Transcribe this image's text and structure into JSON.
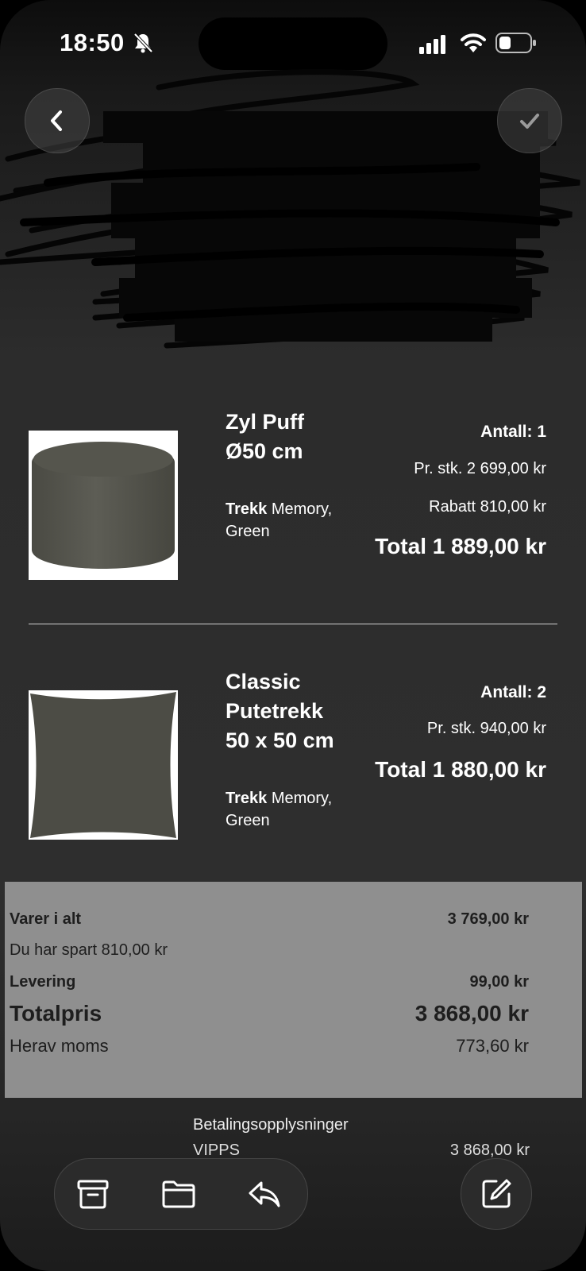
{
  "status": {
    "time": "18:50"
  },
  "items": [
    {
      "name_line1": "Zyl Puff",
      "name_line2": "Ø50 cm",
      "trekk_label": "Trekk",
      "trekk_value": "Memory,",
      "trekk_value2": "Green",
      "quantity": "Antall: 1",
      "unit_price": "Pr. stk. 2 699,00 kr",
      "discount": "Rabatt 810,00 kr",
      "total": "Total 1 889,00 kr"
    },
    {
      "name_line1": "Classic",
      "name_line2": "Putetrekk",
      "name_line3": "50 x 50 cm",
      "trekk_label": "Trekk",
      "trekk_value": "Memory,",
      "trekk_value2": "Green",
      "quantity": "Antall: 2",
      "unit_price": "Pr. stk. 940,00 kr",
      "total": "Total 1 880,00 kr"
    }
  ],
  "summary": {
    "items_label": "Varer i alt",
    "items_value": "3 769,00 kr",
    "saved": "Du har spart 810,00 kr",
    "delivery_label": "Levering",
    "delivery_value": "99,00 kr",
    "total_label": "Totalpris",
    "total_value": "3 868,00 kr",
    "vat_label": "Herav moms",
    "vat_value": "773,60 kr"
  },
  "payment": {
    "label": "Betalingsopplysninger",
    "method": "VIPPS",
    "amount": "3 868,00 kr"
  },
  "icons": {
    "archive": "archive-icon",
    "folder": "folder-icon",
    "reply": "reply-icon",
    "compose": "compose-icon",
    "back": "chevron-left-icon",
    "check": "checkmark-icon"
  }
}
